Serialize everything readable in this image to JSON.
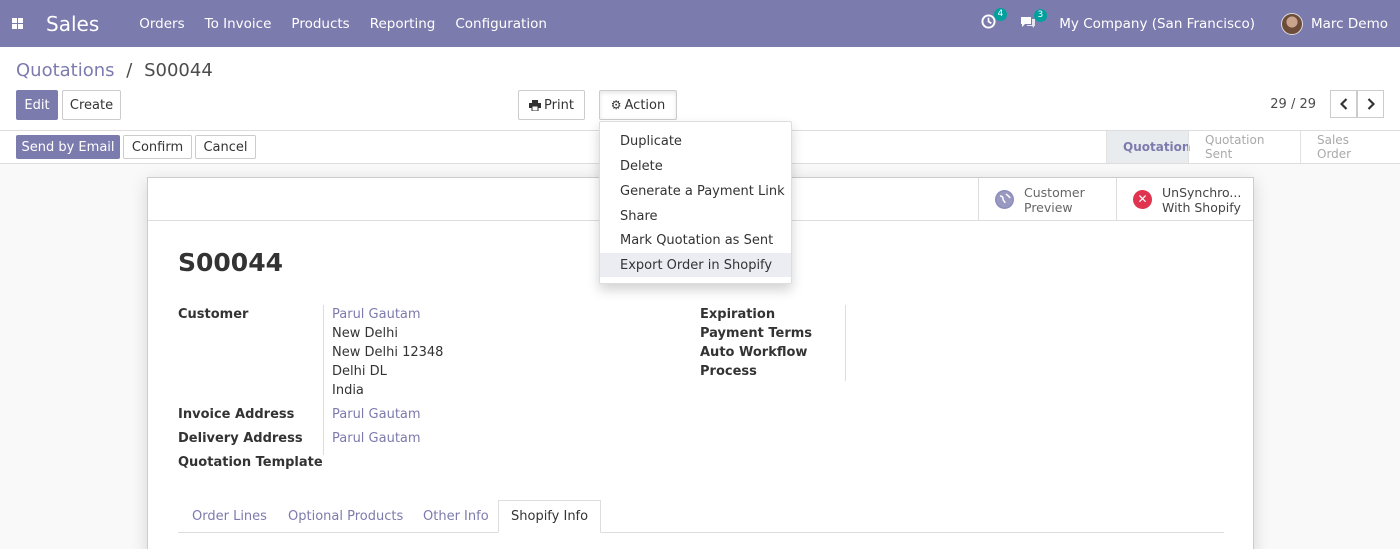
{
  "navbar": {
    "app_name": "Sales",
    "menu": [
      "Orders",
      "To Invoice",
      "Products",
      "Reporting",
      "Configuration"
    ],
    "activity_count": "4",
    "messages_count": "3",
    "company": "My Company (San Francisco)",
    "user": "Marc Demo",
    "color": "#7c7bad"
  },
  "breadcrumb": {
    "parent": "Quotations",
    "separator": "/",
    "current": "S00044"
  },
  "toolbar": {
    "edit": "Edit",
    "create": "Create",
    "print": "Print",
    "action": "Action",
    "print_icon": "print-icon",
    "action_icon": "gear-icon"
  },
  "pager": {
    "value": "29 / 29"
  },
  "status_buttons": {
    "send": "Send by Email",
    "confirm": "Confirm",
    "cancel": "Cancel"
  },
  "stages": [
    "Quotation",
    "Quotation Sent",
    "Sales Order"
  ],
  "active_stage": "Quotation",
  "action_menu": [
    "Duplicate",
    "Delete",
    "Generate a Payment Link",
    "Share",
    "Mark Quotation as Sent",
    "Export Order in Shopify"
  ],
  "action_menu_hover": "Export Order in Shopify",
  "smart_buttons": {
    "preview_l1": "Customer",
    "preview_l2": "Preview",
    "sync_l1": "UnSynchro...",
    "sync_l2": "With Shopify",
    "globe_icon": "globe-icon",
    "sync_icon": "close-circle-icon"
  },
  "record": {
    "name": "S00044",
    "customer_label": "Customer",
    "customer_name": "Parul Gautam",
    "address": [
      "New Delhi",
      "New Delhi 12348",
      "Delhi DL",
      "India"
    ],
    "invoice_label": "Invoice Address",
    "invoice_value": "Parul Gautam",
    "delivery_label": "Delivery Address",
    "delivery_value": "Parul Gautam",
    "template_label": "Quotation Template",
    "expiration_label": "Expiration",
    "payment_terms_label": "Payment Terms",
    "auto_workflow_label": "Auto Workflow",
    "process_label": "Process"
  },
  "tabs": [
    "Order Lines",
    "Optional Products",
    "Other Info",
    "Shopify Info"
  ],
  "active_tab": "Shopify Info"
}
